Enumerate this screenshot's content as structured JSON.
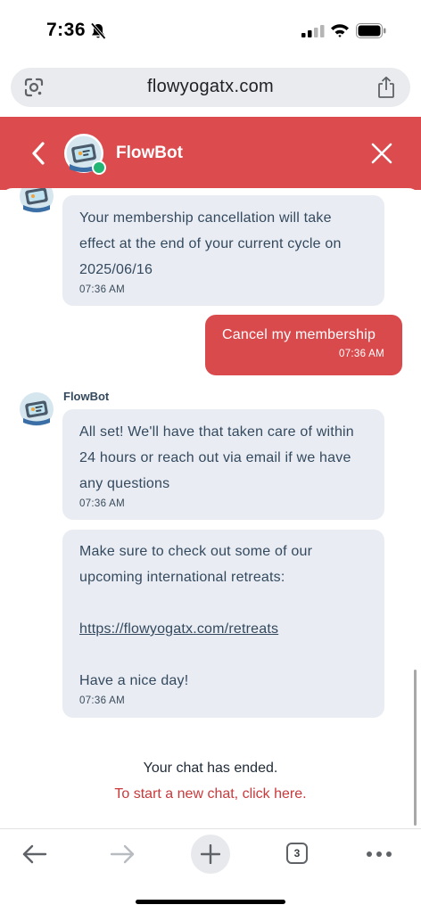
{
  "status_bar": {
    "time": "7:36"
  },
  "browser": {
    "url": "flowyogatx.com",
    "tab_count": "3"
  },
  "chat": {
    "bot_name": "FlowBot",
    "messages": [
      {
        "from": "bot",
        "text": "Your membership cancellation will take effect at the end of your current cycle on 2025/06/16",
        "time": "07:36 AM"
      },
      {
        "from": "user",
        "text": "Cancel my membership",
        "time": "07:36 AM"
      },
      {
        "from": "bot",
        "sender": "FlowBot",
        "text": "All set! We'll have that taken care of within 24 hours or reach out via email if we have any questions",
        "time": "07:36 AM"
      },
      {
        "from": "bot",
        "text_before_link": "Make sure to check out some of our upcoming international retreats:",
        "link": "https://flowyogatx.com/retreats",
        "text_after_link": "Have a nice day!",
        "time": "07:36 AM"
      }
    ],
    "ended_text": "Your chat has ended.",
    "new_chat_link": "To start a new chat, click here."
  },
  "colors": {
    "header_red": "#dc4b4e",
    "user_bubble": "#d94a4d",
    "bot_bubble": "#e9edf3",
    "link_red": "#c9393c",
    "online_green": "#22b573"
  },
  "icons": {
    "status": [
      "bell-slash-icon",
      "cellular-signal-icon",
      "wifi-icon",
      "battery-icon"
    ],
    "url_bar": [
      "google-lens-icon",
      "share-icon"
    ],
    "header": [
      "chevron-left-icon",
      "bot-avatar",
      "close-icon"
    ],
    "toolbar": [
      "arrow-back-icon",
      "arrow-forward-icon",
      "plus-icon",
      "tabs-icon",
      "more-icon"
    ]
  }
}
